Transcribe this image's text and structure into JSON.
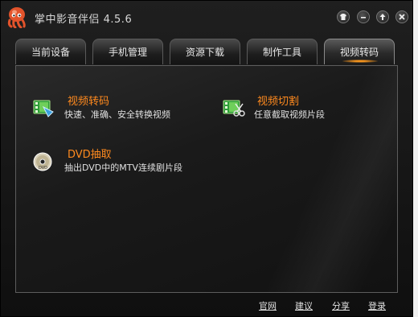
{
  "window": {
    "title": "掌中影音伴侣 4.5.6"
  },
  "tabs": [
    {
      "label": "当前设备"
    },
    {
      "label": "手机管理"
    },
    {
      "label": "资源下载"
    },
    {
      "label": "制作工具"
    },
    {
      "label": "视频转码",
      "active": true
    }
  ],
  "features": [
    {
      "title": "视频转码",
      "desc": "快速、准确、安全转换视频",
      "icon": "video-convert-icon"
    },
    {
      "title": "视频切割",
      "desc": "任意截取视频片段",
      "icon": "video-cut-icon"
    },
    {
      "title": "DVD抽取",
      "desc": "抽出DVD中的MTV连续剧片段",
      "icon": "dvd-icon"
    }
  ],
  "footer": {
    "links": [
      "官网",
      "建议",
      "分享",
      "登录"
    ]
  },
  "colors": {
    "accent": "#ff8a1e",
    "background": "#151515"
  }
}
